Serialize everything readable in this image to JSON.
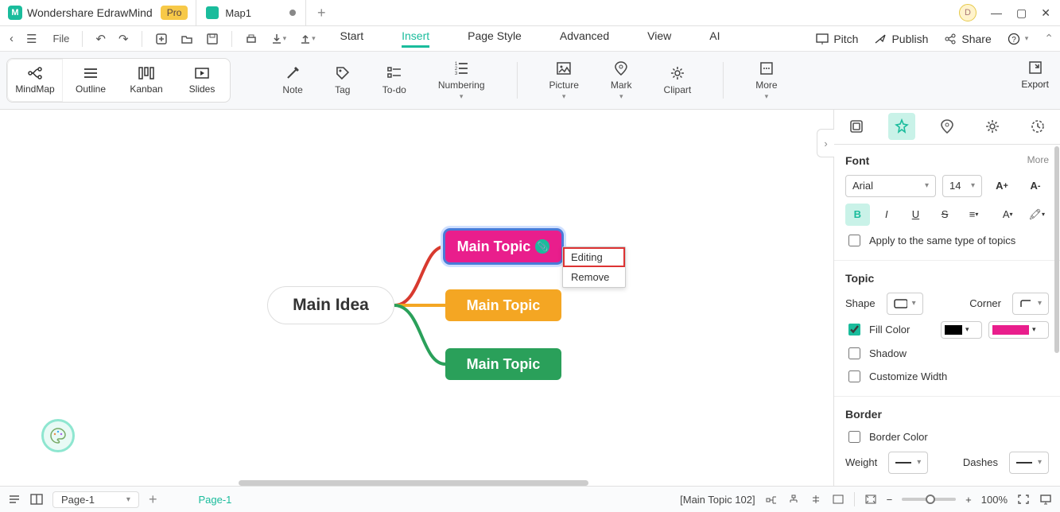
{
  "title": {
    "app_name": "Wondershare EdrawMind",
    "pro_badge": "Pro",
    "doc_name": "Map1",
    "avatar_letter": "D"
  },
  "menubar": {
    "file": "File",
    "tabs": {
      "start": "Start",
      "insert": "Insert",
      "page_style": "Page Style",
      "advanced": "Advanced",
      "view": "View",
      "ai": "AI"
    },
    "right": {
      "pitch": "Pitch",
      "publish": "Publish",
      "share": "Share"
    }
  },
  "ribbon": {
    "views": {
      "mindmap": "MindMap",
      "outline": "Outline",
      "kanban": "Kanban",
      "slides": "Slides"
    },
    "tools": {
      "note": "Note",
      "tag": "Tag",
      "todo": "To-do",
      "numbering": "Numbering",
      "picture": "Picture",
      "mark": "Mark",
      "clipart": "Clipart",
      "more": "More"
    },
    "export": "Export"
  },
  "mindmap": {
    "main": "Main Idea",
    "t1": "Main Topic",
    "t2": "Main Topic",
    "t3": "Main Topic"
  },
  "context_menu": {
    "editing": "Editing",
    "remove": "Remove"
  },
  "panel": {
    "font": {
      "title": "Font",
      "more": "More",
      "family": "Arial",
      "size": "14",
      "apply_same": "Apply to the same type of topics"
    },
    "topic": {
      "title": "Topic",
      "shape_label": "Shape",
      "corner_label": "Corner",
      "fill_label": "Fill Color",
      "shadow_label": "Shadow",
      "custom_width_label": "Customize Width"
    },
    "border": {
      "title": "Border",
      "border_color_label": "Border Color",
      "weight_label": "Weight",
      "dashes_label": "Dashes"
    },
    "colors": {
      "fill_swatch": "#e91e8c",
      "outline_swatch": "#000000"
    }
  },
  "status": {
    "page_sel": "Page-1",
    "page_tab": "Page-1",
    "selection": "[Main Topic 102]",
    "zoom": "100%"
  }
}
